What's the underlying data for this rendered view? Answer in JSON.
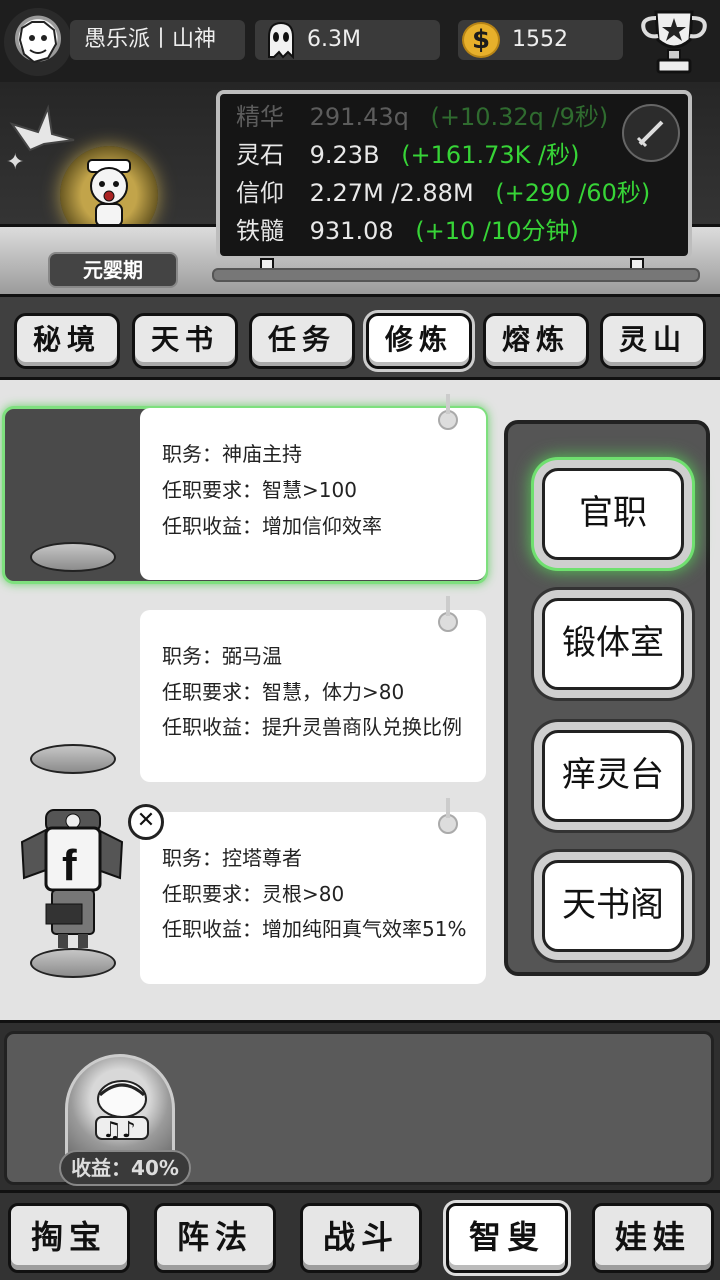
{
  "header": {
    "player_name": "愚乐派丨山神",
    "ghost_count": "6.3M",
    "coins": "1552"
  },
  "hero": {
    "stage": "元婴期"
  },
  "stats": [
    {
      "name": "精华",
      "value": "291.43q",
      "gain": "(+10.32q /9秒)"
    },
    {
      "name": "灵石",
      "value": "9.23B",
      "gain": "(+161.73K /秒)"
    },
    {
      "name": "信仰",
      "value": "2.27M /2.88M",
      "gain": "(+290 /60秒)"
    },
    {
      "name": "铁髓",
      "value": "931.08",
      "gain": "(+10 /10分钟)"
    }
  ],
  "tabs": [
    "秘境",
    "天书",
    "任务",
    "修炼",
    "熔炼",
    "灵山"
  ],
  "active_tab": "修炼",
  "jobs": [
    {
      "title": "职务：神庙主持",
      "requirement": "任职要求：智慧>100",
      "benefit": "任职收益：增加信仰效率"
    },
    {
      "title": "职务：弼马温",
      "requirement": "任职要求：智慧，体力>80",
      "benefit": "任职收益：提升灵兽商队兑换比例"
    },
    {
      "title": "职务：控塔尊者",
      "requirement": "任职要求：灵根>80",
      "benefit": "任职收益：增加纯阳真气效率51%"
    }
  ],
  "side_menu": [
    "官职",
    "锻体室",
    "痒灵台",
    "天书阁"
  ],
  "close_symbol": "✕",
  "income": "收益：40%",
  "bottom_nav": [
    "掏宝",
    "阵法",
    "战斗",
    "智叟",
    "娃娃"
  ],
  "active_nav": "智叟",
  "colors": {
    "gain": "#37d437",
    "highlight": "#6fe06f"
  },
  "icons": [
    "ghost-icon",
    "coin-icon",
    "trophy-icon",
    "sword-icon",
    "crane-icon",
    "close-icon"
  ]
}
